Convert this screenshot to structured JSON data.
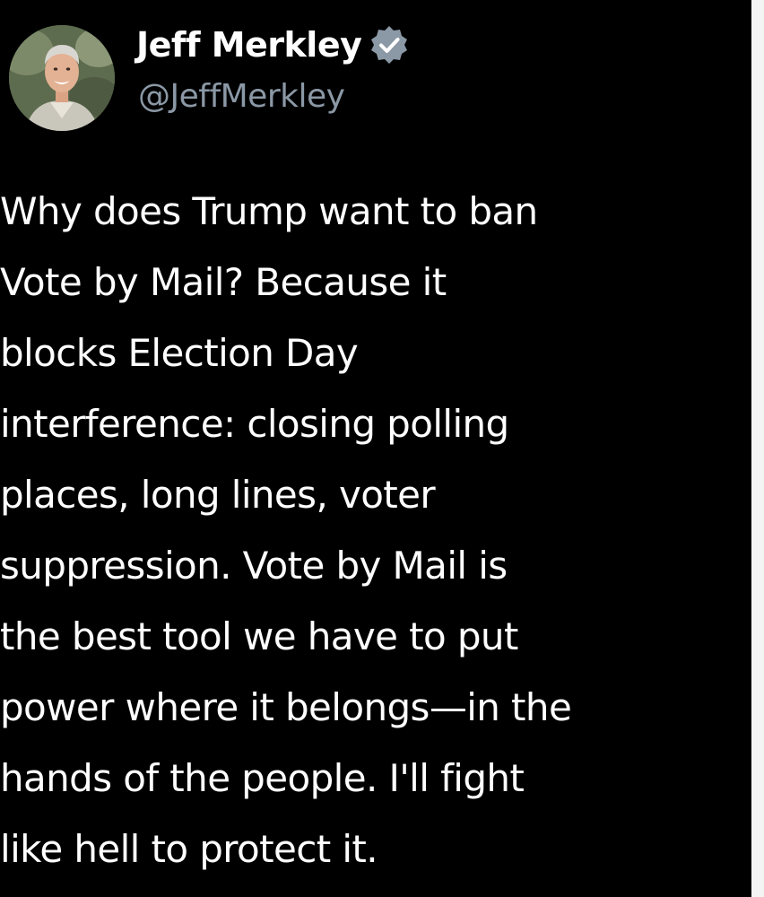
{
  "author": {
    "display_name": "Jeff Merkley",
    "handle": "@JeffMerkley",
    "avatar_icon": "profile-photo",
    "verified_icon": "verified-badge-icon",
    "verified_color": "#8b98a5"
  },
  "tweet": {
    "lines": [
      "Why does Trump want to ban",
      "Vote by Mail? Because it",
      "blocks Election Day",
      "interference: closing polling",
      "places, long lines, voter",
      "suppression. Vote by Mail is",
      "the best tool we have to put",
      "power where it belongs—in the",
      "hands of the people. I'll fight",
      "like hell to protect it."
    ]
  },
  "colors": {
    "background": "#000000",
    "text": "#ffffff",
    "secondary_text": "#8b98a5"
  }
}
